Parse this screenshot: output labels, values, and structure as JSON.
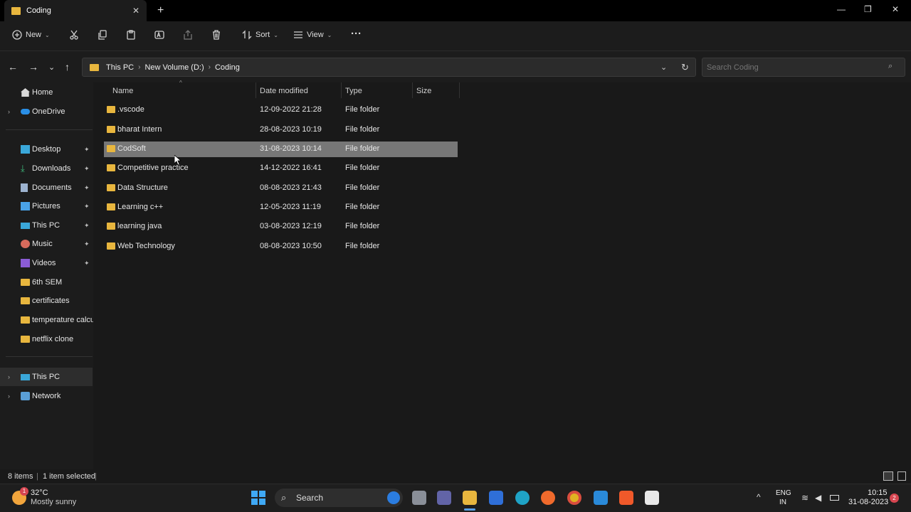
{
  "window": {
    "tab_title": "Coding",
    "close": "✕",
    "new_tab": "+",
    "minimize": "—",
    "maximize": "❐",
    "close_window": "✕"
  },
  "toolbar": {
    "new_label": "New",
    "sort_label": "Sort",
    "view_label": "View",
    "more": "···"
  },
  "address": {
    "crumbs": [
      "This PC",
      "New Volume (D:)",
      "Coding"
    ],
    "sep": "›",
    "refresh": "↻",
    "dropdown": "⌄"
  },
  "search": {
    "placeholder": "Search Coding",
    "icon": "⌕"
  },
  "nav": {
    "back": "←",
    "forward": "→",
    "recent": "⌄",
    "up": "↑"
  },
  "sidebar": {
    "items": [
      {
        "label": "Home",
        "icon": "home-icon"
      },
      {
        "label": "OneDrive",
        "icon": "cloud-icon",
        "expand": "›"
      },
      {
        "label": "Desktop",
        "icon": "desktop-icon",
        "pin": "📌"
      },
      {
        "label": "Downloads",
        "icon": "download-icon",
        "pin": "📌"
      },
      {
        "label": "Documents",
        "icon": "document-icon",
        "pin": "📌"
      },
      {
        "label": "Pictures",
        "icon": "picture-icon",
        "pin": "📌"
      },
      {
        "label": "This PC",
        "icon": "pc-icon",
        "pin": "📌"
      },
      {
        "label": "Music",
        "icon": "music-icon",
        "pin": "📌"
      },
      {
        "label": "Videos",
        "icon": "video-icon",
        "pin": "📌"
      },
      {
        "label": "6th SEM",
        "icon": "folder-icon"
      },
      {
        "label": "certificates",
        "icon": "folder-icon"
      },
      {
        "label": "temperature calcula",
        "icon": "folder-icon"
      },
      {
        "label": "netflix clone",
        "icon": "folder-icon"
      },
      {
        "label": "This PC",
        "icon": "pc-icon",
        "expand": "›"
      },
      {
        "label": "Network",
        "icon": "network-icon",
        "expand": "›"
      }
    ]
  },
  "columns": {
    "name": "Name",
    "date": "Date modified",
    "type": "Type",
    "size": "Size",
    "sort_arrow": "^"
  },
  "files": [
    {
      "name": ".vscode",
      "date": "12-09-2022 21:28",
      "type": "File folder"
    },
    {
      "name": "bharat Intern",
      "date": "28-08-2023 10:19",
      "type": "File folder"
    },
    {
      "name": "CodSoft",
      "date": "31-08-2023 10:14",
      "type": "File folder"
    },
    {
      "name": "Competitive practice",
      "date": "14-12-2022 16:41",
      "type": "File folder"
    },
    {
      "name": "Data Structure",
      "date": "08-08-2023 21:43",
      "type": "File folder"
    },
    {
      "name": "Learning c++",
      "date": "12-05-2023 11:19",
      "type": "File folder"
    },
    {
      "name": "learning java",
      "date": "03-08-2023 12:19",
      "type": "File folder"
    },
    {
      "name": "Web Technology",
      "date": "08-08-2023 10:50",
      "type": "File folder"
    }
  ],
  "status": {
    "count": "8 items",
    "selected": "1 item selected",
    "bar": "|"
  },
  "taskbar": {
    "weather_temp": "32°C",
    "weather_desc": "Mostly sunny",
    "weather_badge": "1",
    "search_label": "Search",
    "lang1": "ENG",
    "lang2": "IN",
    "time": "10:15",
    "date": "31-08-2023",
    "notif_count": "2",
    "tray_arrow": "^"
  },
  "colors": {
    "accent": "#e8b63e",
    "selected_row": "#777777",
    "background": "#191919"
  }
}
